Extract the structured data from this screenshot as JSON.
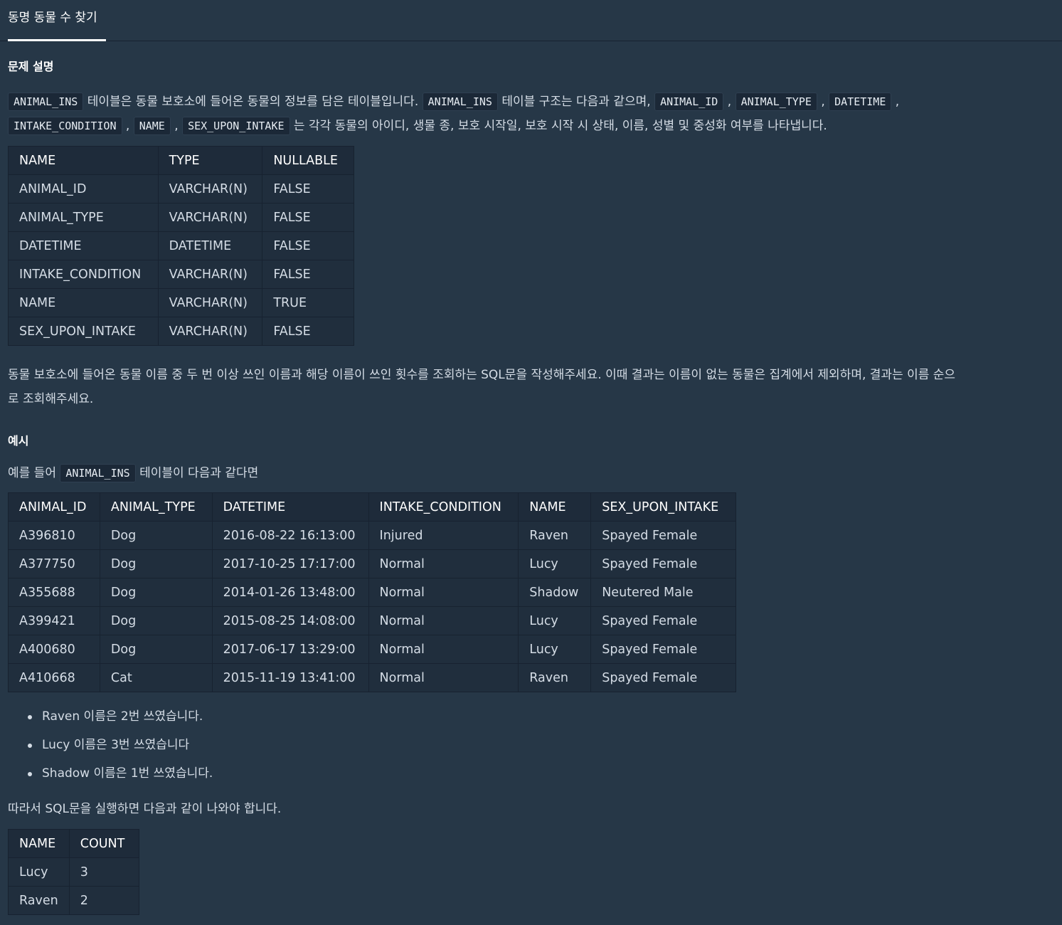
{
  "tab": {
    "title": "동명 동물 수 찾기"
  },
  "problem": {
    "heading": "문제 설명",
    "intro": {
      "code_animal_ins": "ANIMAL_INS",
      "t1": " 테이블은 동물 보호소에 들어온 동물의 정보를 담은 테이블입니다. ",
      "t2": " 테이블 구조는 다음과 같으며, ",
      "code_animal_id": "ANIMAL_ID",
      "code_animal_type": "ANIMAL_TYPE",
      "code_datetime": "DATETIME",
      "code_intake_condition": "INTAKE_CONDITION",
      "code_name": "NAME",
      "code_sex_upon_intake": "SEX_UPON_INTAKE",
      "comma": ",",
      "t3": " 는 각각 동물의 아이디, 생물 종, 보호 시작일, 보호 시작 시 상태, 이름, 성별 및 중성화 여부를 나타냅니다."
    },
    "description_line1": "동물 보호소에 들어온 동물 이름 중 두 번 이상 쓰인 이름과 해당 이름이 쓰인 횟수를 조회하는 SQL문을 작성해주세요. 이때 결과는 이름이 없는 동물은 집계에서 제외하며, 결과는 이름 순으",
    "description_line2": "로 조회해주세요."
  },
  "schema_table": {
    "headers": [
      "NAME",
      "TYPE",
      "NULLABLE"
    ],
    "rows": [
      [
        "ANIMAL_ID",
        "VARCHAR(N)",
        "FALSE"
      ],
      [
        "ANIMAL_TYPE",
        "VARCHAR(N)",
        "FALSE"
      ],
      [
        "DATETIME",
        "DATETIME",
        "FALSE"
      ],
      [
        "INTAKE_CONDITION",
        "VARCHAR(N)",
        "FALSE"
      ],
      [
        "NAME",
        "VARCHAR(N)",
        "TRUE"
      ],
      [
        "SEX_UPON_INTAKE",
        "VARCHAR(N)",
        "FALSE"
      ]
    ]
  },
  "example": {
    "heading": "예시",
    "lead_pre": "예를 들어 ",
    "lead_code": "ANIMAL_INS",
    "lead_post": " 테이블이 다음과 같다면",
    "bullets": [
      "Raven 이름은 2번 쓰였습니다.",
      "Lucy 이름은 3번 쓰였습니다",
      "Shadow 이름은 1번 쓰였습니다."
    ],
    "result_lead": "따라서 SQL문을 실행하면 다음과 같이 나와야 합니다."
  },
  "example_table": {
    "headers": [
      "ANIMAL_ID",
      "ANIMAL_TYPE",
      "DATETIME",
      "INTAKE_CONDITION",
      "NAME",
      "SEX_UPON_INTAKE"
    ],
    "rows": [
      [
        "A396810",
        "Dog",
        "2016-08-22 16:13:00",
        "Injured",
        "Raven",
        "Spayed Female"
      ],
      [
        "A377750",
        "Dog",
        "2017-10-25 17:17:00",
        "Normal",
        "Lucy",
        "Spayed Female"
      ],
      [
        "A355688",
        "Dog",
        "2014-01-26 13:48:00",
        "Normal",
        "Shadow",
        "Neutered Male"
      ],
      [
        "A399421",
        "Dog",
        "2015-08-25 14:08:00",
        "Normal",
        "Lucy",
        "Spayed Female"
      ],
      [
        "A400680",
        "Dog",
        "2017-06-17 13:29:00",
        "Normal",
        "Lucy",
        "Spayed Female"
      ],
      [
        "A410668",
        "Cat",
        "2015-11-19 13:41:00",
        "Normal",
        "Raven",
        "Spayed Female"
      ]
    ]
  },
  "result_table": {
    "headers": [
      "NAME",
      "COUNT"
    ],
    "rows": [
      [
        "Lucy",
        "3"
      ],
      [
        "Raven",
        "2"
      ]
    ]
  }
}
